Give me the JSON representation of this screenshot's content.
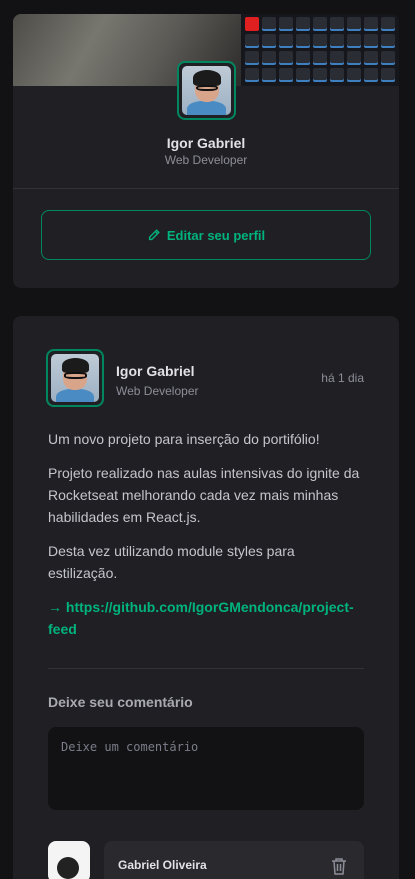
{
  "sidebar": {
    "name": "Igor Gabriel",
    "role": "Web Developer",
    "edit_label": "Editar seu perfil",
    "icons": {
      "edit": "pencil-icon"
    }
  },
  "post": {
    "author": {
      "name": "Igor Gabriel",
      "role": "Web Developer"
    },
    "time": "há 1 dia",
    "paragraphs": [
      "Um novo projeto para inserção do portifólio!",
      "Projeto realizado nas aulas intensivas do ignite da Rocketseat melhorando cada vez mais minhas habilidades em React.js.",
      "Desta vez utilizando module styles para estilização."
    ],
    "link": "https://github.com/IgorGMendonca/project-feed",
    "link_icon": "→",
    "comment_heading": "Deixe seu comentário",
    "comment_placeholder": "Deixe um comentário"
  },
  "comments": [
    {
      "author": "Gabriel Oliveira",
      "icon": "trash-icon"
    }
  ],
  "colors": {
    "accent": "#00b37e",
    "accent_border": "#00875f",
    "background": "#121214",
    "card": "#202024"
  }
}
